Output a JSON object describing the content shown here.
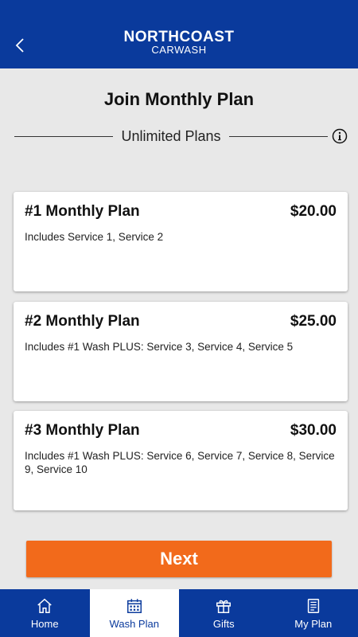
{
  "header": {
    "brand_main": "NORTHCOAST",
    "brand_sub": "CARWASH",
    "bg_color": "#0a3a9c"
  },
  "page": {
    "title": "Join Monthly Plan",
    "section_label": "Unlimited Plans"
  },
  "plans": [
    {
      "name": "#1 Monthly Plan",
      "price": "$20.00",
      "description": "Includes Service 1, Service 2"
    },
    {
      "name": "#2 Monthly Plan",
      "price": "$25.00",
      "description": "Includes #1 Wash PLUS: Service 3, Service 4, Service 5"
    },
    {
      "name": "#3 Monthly Plan",
      "price": "$30.00",
      "description": "Includes #1 Wash PLUS: Service 6, Service 7, Service 8, Service 9, Service 10"
    }
  ],
  "actions": {
    "next_label": "Next",
    "next_color": "#f26a1b"
  },
  "tabs": [
    {
      "label": "Home",
      "icon": "home-icon",
      "active": false
    },
    {
      "label": "Wash Plan",
      "icon": "calendar-icon",
      "active": true
    },
    {
      "label": "Gifts",
      "icon": "gift-icon",
      "active": false
    },
    {
      "label": "My Plan",
      "icon": "document-icon",
      "active": false
    }
  ]
}
